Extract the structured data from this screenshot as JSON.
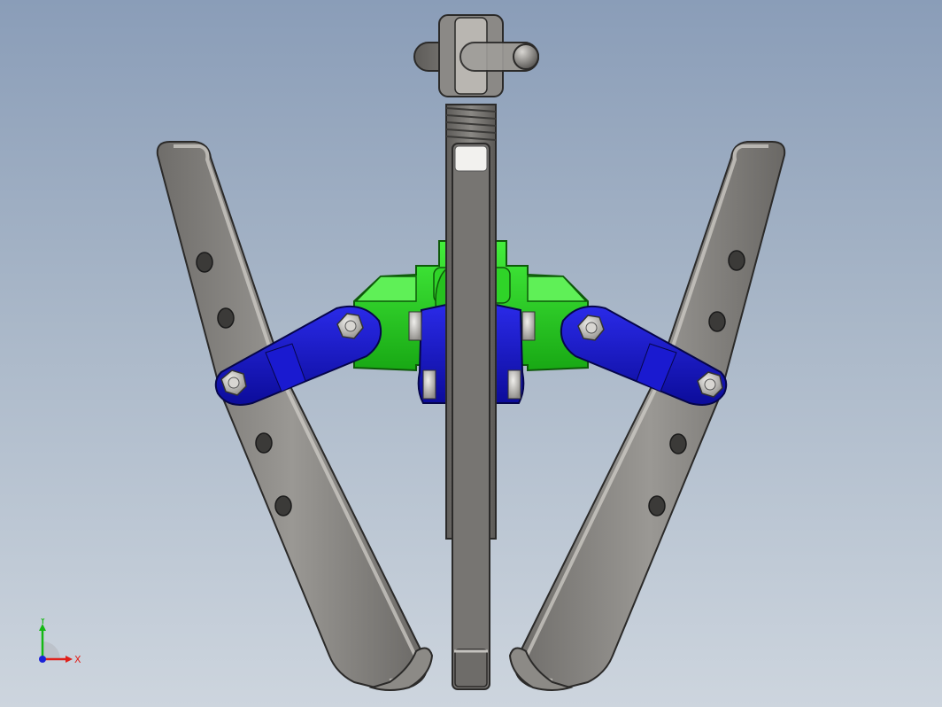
{
  "viewport": {
    "background_top": "#8a9db8",
    "background_bottom": "#cdd5de"
  },
  "model": {
    "description_icon": "gear-puller-3d-model",
    "colors": {
      "arm": "#8b8986",
      "arm_light": "#b9b6b1",
      "bracket": "#1fd11a",
      "link": "#1414c8",
      "bolt": "#c8c6c2",
      "screw": "#7f7d7a"
    }
  },
  "triad": {
    "x_label": "X",
    "y_label": "Y",
    "x_color": "#e0201a",
    "y_color": "#14b814",
    "z_color": "#1a22d8"
  }
}
